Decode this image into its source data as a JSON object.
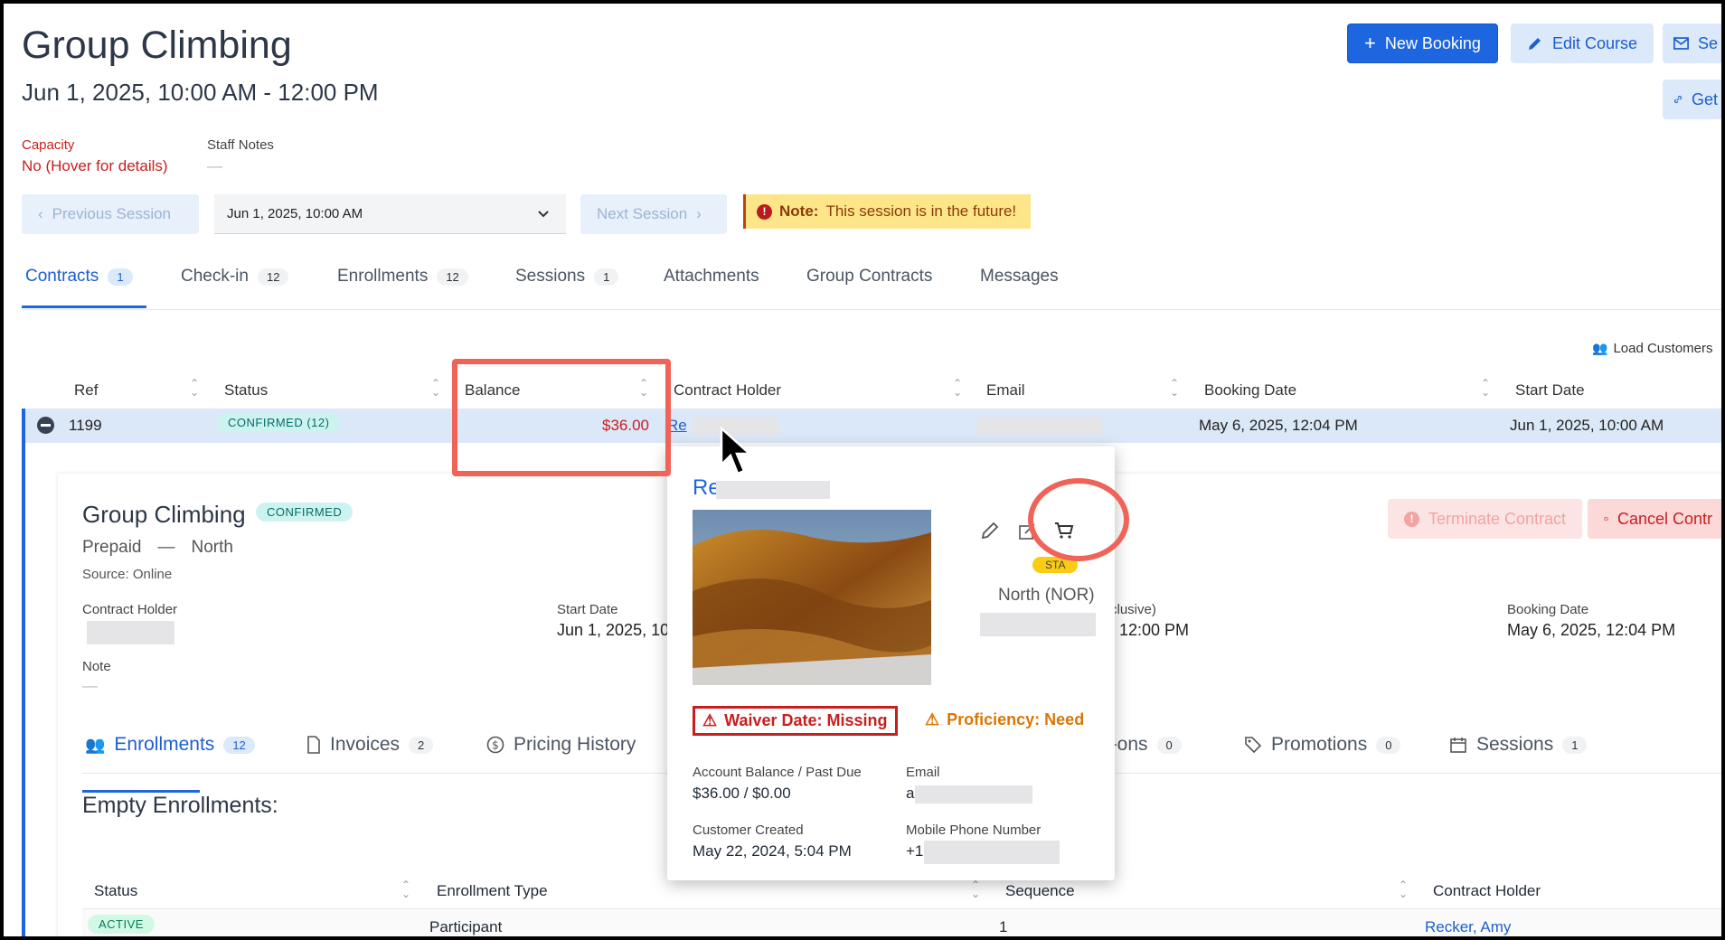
{
  "header": {
    "title": "Group Climbing",
    "date_range": "Jun 1, 2025, 10:00 AM - 12:00 PM",
    "buttons": {
      "new_booking": "New Booking",
      "edit_course": "Edit Course",
      "send": "Se",
      "get": "Get"
    }
  },
  "info": {
    "capacity_label": "Capacity",
    "capacity_value": "No (Hover for details)",
    "staff_notes_label": "Staff Notes",
    "staff_notes_value": "—"
  },
  "session_nav": {
    "previous": "Previous Session",
    "selected": "Jun 1, 2025, 10:00 AM",
    "next": "Next Session",
    "note_bold": "Note:",
    "note_text": "This session is in the future!"
  },
  "tabs": [
    {
      "label": "Contracts",
      "count": "1"
    },
    {
      "label": "Check-in",
      "count": "12"
    },
    {
      "label": "Enrollments",
      "count": "12"
    },
    {
      "label": "Sessions",
      "count": "1"
    },
    {
      "label": "Attachments"
    },
    {
      "label": "Group Contracts"
    },
    {
      "label": "Messages"
    }
  ],
  "load_customers": "Load Customers",
  "table": {
    "headers": [
      "Ref",
      "Status",
      "Balance",
      "Contract Holder",
      "Email",
      "Booking Date",
      "Start Date"
    ],
    "row": {
      "ref": "1199",
      "status": "CONFIRMED (12)",
      "balance": "$36.00",
      "holder": "Re",
      "booking_date": "May 6, 2025, 12:04 PM",
      "start_date": "Jun 1, 2025, 10:00 AM"
    }
  },
  "detail": {
    "title": "Group Climbing",
    "status": "CONFIRMED",
    "payment": "Prepaid",
    "dash": "—",
    "location": "North",
    "source": "Source: Online",
    "contract_holder_label": "Contract Holder",
    "start_date_label": "Start Date",
    "start_date_value": "Jun 1, 2025, 10:",
    "end_label": "clusive)",
    "end_value": ", 12:00 PM",
    "booking_date_label": "Booking Date",
    "booking_date_value": "May 6, 2025, 12:04 PM",
    "note_label": "Note",
    "note_value": "—",
    "terminate": "Terminate Contract",
    "cancel": "Cancel Contr",
    "subtabs": [
      {
        "label": "Enrollments",
        "count": "12"
      },
      {
        "label": "Invoices",
        "count": "2"
      },
      {
        "label": "Pricing History"
      },
      {
        "label": "d-ons",
        "count": "0"
      },
      {
        "label": "Promotions",
        "count": "0"
      },
      {
        "label": "Sessions",
        "count": "1"
      }
    ],
    "empty_enrollments": "Empty Enrollments:",
    "enroll_headers": [
      "Status",
      "Enrollment Type",
      "Sequence",
      "Contract Holder"
    ],
    "enroll_row": {
      "status": "ACTIVE",
      "type": "Participant",
      "sequence": "1",
      "holder": "Recker, Amy"
    }
  },
  "popup": {
    "name": "Re",
    "badge": "STA",
    "location": "North (NOR)",
    "waiver": "Waiver Date: Missing",
    "proficiency": "Proficiency: Need",
    "balance_label": "Account Balance / Past Due",
    "balance_value": "$36.00 / $0.00",
    "email_label": "Email",
    "email_value": "a",
    "created_label": "Customer Created",
    "created_value": "May 22, 2024, 5:04 PM",
    "phone_label": "Mobile Phone Number",
    "phone_value": "+1"
  },
  "colors": {
    "primary": "#1d66e0",
    "danger": "#c81e1e",
    "highlight": "#ef6358",
    "warning": "#d97706"
  }
}
